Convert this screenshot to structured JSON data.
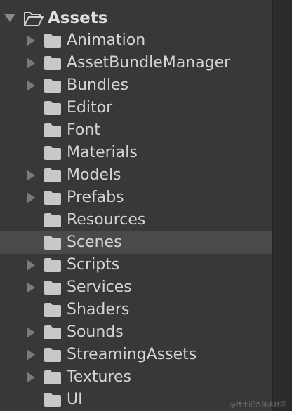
{
  "tree": {
    "root": {
      "label": "Assets",
      "expanded": true,
      "icon": "folder-open-icon"
    },
    "items": [
      {
        "label": "Animation",
        "has_children": true
      },
      {
        "label": "AssetBundleManager",
        "has_children": true
      },
      {
        "label": "Bundles",
        "has_children": true
      },
      {
        "label": "Editor",
        "has_children": false
      },
      {
        "label": "Font",
        "has_children": false
      },
      {
        "label": "Materials",
        "has_children": false
      },
      {
        "label": "Models",
        "has_children": true
      },
      {
        "label": "Prefabs",
        "has_children": true
      },
      {
        "label": "Resources",
        "has_children": false
      },
      {
        "label": "Scenes",
        "has_children": false,
        "selected": true
      },
      {
        "label": "Scripts",
        "has_children": true
      },
      {
        "label": "Services",
        "has_children": true
      },
      {
        "label": "Shaders",
        "has_children": false
      },
      {
        "label": "Sounds",
        "has_children": true
      },
      {
        "label": "StreamingAssets",
        "has_children": true
      },
      {
        "label": "Textures",
        "has_children": true
      },
      {
        "label": "UI",
        "has_children": false
      }
    ]
  },
  "watermark": "@稀土掘金技术社区",
  "colors": {
    "background": "#383838",
    "selected_row": "#4a4a4a",
    "text": "#d4d4d4",
    "folder": "#c8c8c8",
    "arrow": "#7a7a7a"
  }
}
